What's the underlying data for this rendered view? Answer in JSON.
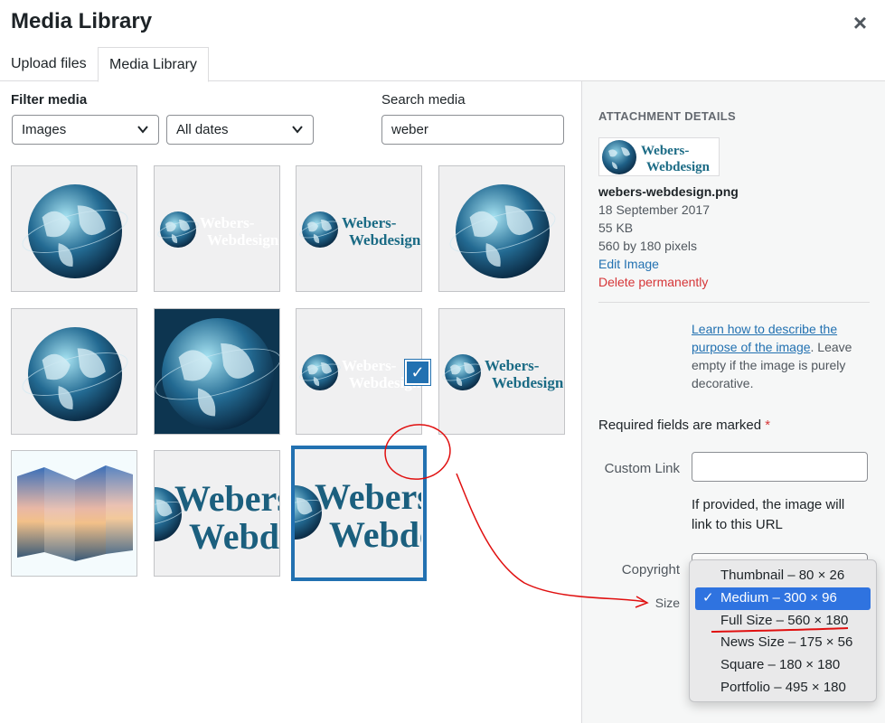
{
  "header": {
    "title": "Media Library",
    "close_glyph": "×"
  },
  "tabs": [
    {
      "label": "Upload files"
    },
    {
      "label": "Media Library"
    }
  ],
  "filters": {
    "label": "Filter media",
    "type_select": "Images",
    "date_select": "All dates",
    "search_label": "Search media",
    "search_value": "weber"
  },
  "grid": {
    "items": [
      {
        "kind": "globe"
      },
      {
        "kind": "logo-faded"
      },
      {
        "kind": "logo"
      },
      {
        "kind": "globe"
      },
      {
        "kind": "globe"
      },
      {
        "kind": "globe-dark"
      },
      {
        "kind": "logo-faded"
      },
      {
        "kind": "logo"
      },
      {
        "kind": "panorama"
      },
      {
        "kind": "logo-large"
      },
      {
        "kind": "logo-large",
        "selected": true
      }
    ],
    "check_glyph": "✓"
  },
  "details": {
    "heading": "ATTACHMENT DETAILS",
    "logo_line1": "Webers-",
    "logo_line2": "Webdesign",
    "filename": "webers-webdesign.png",
    "date": "18 September 2017",
    "filesize": "55 KB",
    "dimensions": "560 by 180 pixels",
    "edit_link": "Edit Image",
    "delete_link": "Delete permanently",
    "learn_link": "Learn how to describe the purpose of the image",
    "learn_rest": ". Leave empty if the image is purely decorative.",
    "required_text": "Required fields are marked ",
    "required_star": "*",
    "custom_link_label": "Custom Link",
    "custom_link_value": "",
    "custom_link_hint": "If provided, the image will link to this URL",
    "copyright_label": "Copyright",
    "size_label": "Size"
  },
  "size_dropdown": {
    "selected": "Medium – 300 × 96",
    "options": [
      {
        "label": "Thumbnail – 80 × 26"
      },
      {
        "label": "Medium – 300 × 96",
        "checked": true
      },
      {
        "label": "Full Size – 560 × 180"
      },
      {
        "label": "News Size – 175 × 56"
      },
      {
        "label": "Square – 180 × 180"
      },
      {
        "label": "Portfolio – 495 × 180"
      }
    ]
  },
  "colors": {
    "accent": "#2271b1",
    "danger": "#d63638",
    "annotation": "#e01010",
    "dropdown_highlight": "#2f73e0"
  }
}
